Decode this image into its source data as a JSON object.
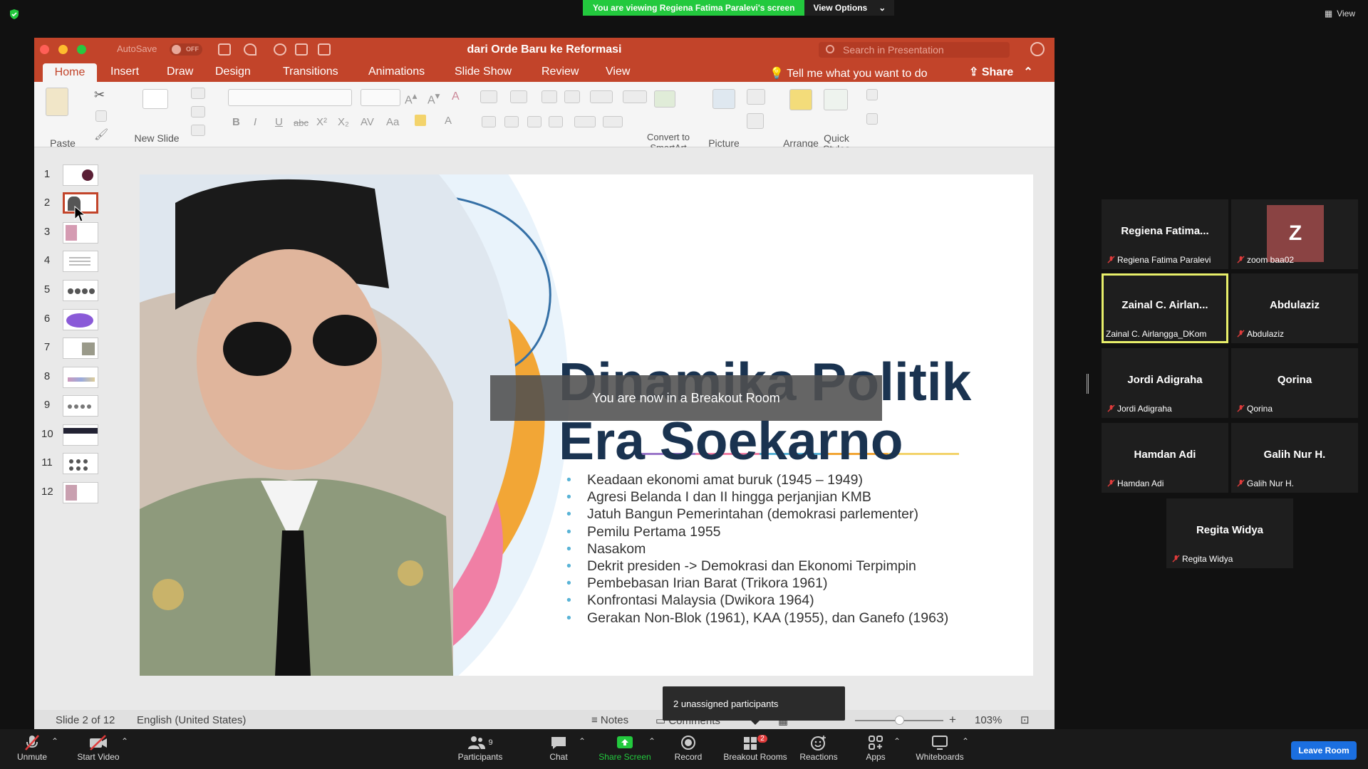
{
  "zoom_top": {
    "viewing_banner": "You are viewing Regiena Fatima Paralevi's screen",
    "view_options": "View Options",
    "view_button": "View"
  },
  "ppt": {
    "autosave_label": "AutoSave",
    "autosave_state": "OFF",
    "doc_title": "dari Orde Baru ke Reformasi",
    "search_placeholder": "Search in Presentation",
    "tabs": [
      "Home",
      "Insert",
      "Draw",
      "Design",
      "Transitions",
      "Animations",
      "Slide Show",
      "Review",
      "View"
    ],
    "tell_me": "Tell me what you want to do",
    "share": "Share",
    "ribbon": {
      "paste": "Paste",
      "new_slide": "New Slide",
      "convert_smartart": "Convert to SmartArt",
      "picture": "Picture",
      "arrange": "Arrange",
      "quick_styles": "Quick Styles"
    },
    "thumbnails": [
      "1",
      "2",
      "3",
      "4",
      "5",
      "6",
      "7",
      "8",
      "9",
      "10",
      "11",
      "12"
    ],
    "selected_slide": 2,
    "slide": {
      "title_line1": "Dinamika Politik",
      "title_line2": "Era Soekarno",
      "bullets": [
        "Keadaan ekonomi amat buruk (1945 – 1949)",
        "Agresi Belanda I dan II hingga perjanjian KMB",
        "Jatuh Bangun Pemerintahan (demokrasi parlementer)",
        "Pemilu Pertama 1955",
        "Nasakom",
        "Dekrit presiden -> Demokrasi dan Ekonomi Terpimpin",
        "Pembebasan Irian Barat (Trikora 1961)",
        "Konfrontasi Malaysia (Dwikora 1964)",
        "Gerakan Non-Blok (1961), KAA (1955), dan Ganefo (1963)"
      ]
    },
    "status": {
      "slide_of": "Slide 2 of 12",
      "language": "English (United States)",
      "notes": "Notes",
      "comments": "Comments",
      "zoom": "103%"
    }
  },
  "overlays": {
    "breakout_message": "You are now in a Breakout Room",
    "unassigned": "2 unassigned participants"
  },
  "gallery": [
    {
      "big": "Regiena Fatima...",
      "name": "Regiena Fatima Paralevi"
    },
    {
      "big": "Z",
      "name": "zoom baa02"
    },
    {
      "big": "Zainal C. Airlan...",
      "name": "Zainal C. Airlangga_DKom"
    },
    {
      "big": "Abdulaziz",
      "name": "Abdulaziz"
    },
    {
      "big": "Jordi Adigraha",
      "name": "Jordi Adigraha"
    },
    {
      "big": "Qorina",
      "name": "Qorina"
    },
    {
      "big": "Hamdan Adi",
      "name": "Hamdan Adi"
    },
    {
      "big": "Galih Nur H.",
      "name": "Galih Nur H."
    },
    {
      "big": "Regita Widya",
      "name": "Regita Widya"
    }
  ],
  "bottom_bar": {
    "unmute": "Unmute",
    "start_video": "Start Video",
    "participants": "Participants",
    "participants_count": "9",
    "chat": "Chat",
    "share_screen": "Share Screen",
    "record": "Record",
    "breakout_rooms": "Breakout Rooms",
    "breakout_badge": "2",
    "reactions": "Reactions",
    "apps": "Apps",
    "whiteboards": "Whiteboards",
    "leave_room": "Leave Room"
  },
  "colors": {
    "ppt_accent": "#c2442a",
    "zoom_green": "#23c93e",
    "active_speaker": "#e8ef6a",
    "leave_blue": "#1b6fe0"
  }
}
